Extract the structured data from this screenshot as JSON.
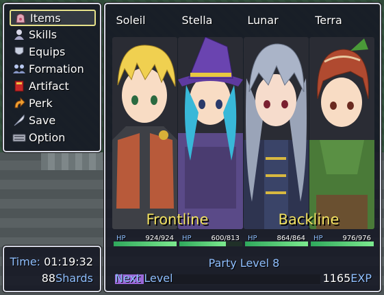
{
  "menu": {
    "items": [
      {
        "label": "Items",
        "icon": "bag-icon",
        "selected": true
      },
      {
        "label": "Skills",
        "icon": "skills-icon",
        "selected": false
      },
      {
        "label": "Equips",
        "icon": "armor-icon",
        "selected": false
      },
      {
        "label": "Formation",
        "icon": "formation-icon",
        "selected": false
      },
      {
        "label": "Artifact",
        "icon": "artifact-book-icon",
        "selected": false
      },
      {
        "label": "Perk",
        "icon": "perk-arrow-icon",
        "selected": false
      },
      {
        "label": "Save",
        "icon": "quill-icon",
        "selected": false
      },
      {
        "label": "Option",
        "icon": "keyboard-icon",
        "selected": false
      }
    ]
  },
  "status": {
    "time_label": "Time:",
    "time_value": "01:19:32",
    "shards_value": "88",
    "shards_label": "Shards"
  },
  "party": {
    "members": [
      {
        "name": "Soleil",
        "hp_label": "HP",
        "hp": "924/924",
        "hp_fraction": 1.0
      },
      {
        "name": "Stella",
        "hp_label": "HP",
        "hp": "600/813",
        "hp_fraction": 0.738
      },
      {
        "name": "Lunar",
        "hp_label": "HP",
        "hp": "864/864",
        "hp_fraction": 1.0
      },
      {
        "name": "Terra",
        "hp_label": "HP",
        "hp": "976/976",
        "hp_fraction": 1.0
      }
    ],
    "frontline_label": "Frontline",
    "backline_label": "Backline",
    "party_level": "Party Level 8",
    "next_level_label": "Next Level",
    "next_level_fraction": 0.14,
    "exp_value": "1165",
    "exp_unit": "EXP"
  },
  "colors": {
    "accent": "#8fbfff",
    "gold": "#f0e060",
    "hp_bar": "#2fa85c",
    "exp_bar": "#9a68d8"
  }
}
